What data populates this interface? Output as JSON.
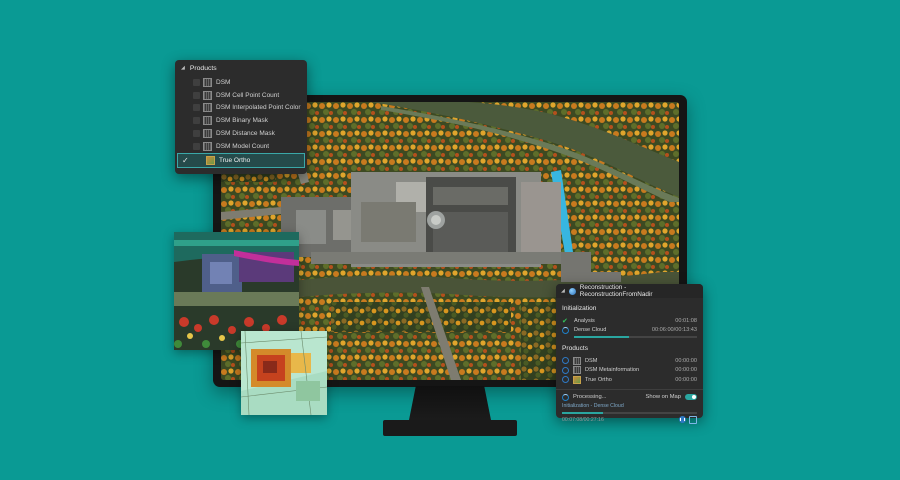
{
  "products_panel": {
    "title": "Products",
    "items": [
      {
        "label": "DSM"
      },
      {
        "label": "DSM Cell Point Count"
      },
      {
        "label": "DSM Interpolated Point Color"
      },
      {
        "label": "DSM Binary Mask"
      },
      {
        "label": "DSM Distance Mask"
      },
      {
        "label": "DSM Model Count"
      },
      {
        "label": "True Ortho",
        "checked": true
      }
    ]
  },
  "reconstruction_panel": {
    "title": "Reconstruction - ReconstructionFromNadir",
    "initialization_title": "Initialization",
    "steps": [
      {
        "label": "Analysis",
        "time": "00:01:08",
        "status": "done"
      },
      {
        "label": "Dense Cloud",
        "time": "00:06:00/00:13:43",
        "status": "running",
        "progress": 0.45
      }
    ],
    "products_title": "Products",
    "products": [
      {
        "label": "DSM",
        "time": "00:00:00"
      },
      {
        "label": "DSM Metainformation",
        "time": "00:00:00"
      },
      {
        "label": "True Ortho",
        "time": "00:00:00"
      }
    ],
    "processing_label": "Processing...",
    "show_on_map_label": "Show on Map",
    "show_on_map": true,
    "stage_text": "Initialization - Dense Cloud",
    "overall_progress": 0.3,
    "elapsed_text": "00:07:08/00:27:16"
  },
  "colors": {
    "background": "#0a9a94",
    "panel": "#2c2c2c",
    "accent": "#2aa6a0",
    "success": "#33c25b",
    "selection": "#254b4b"
  }
}
